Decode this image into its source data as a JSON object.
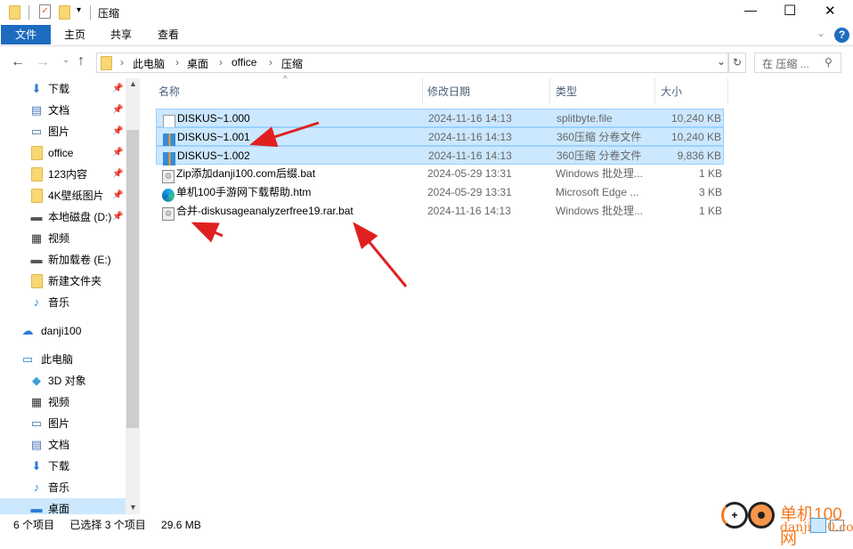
{
  "window": {
    "title": "压缩",
    "minimize": "—",
    "maximize": "☐",
    "close": "✕",
    "help": "?"
  },
  "ribbon": {
    "tabs": [
      "文件",
      "主页",
      "共享",
      "查看"
    ]
  },
  "address": {
    "crumbs": [
      "此电脑",
      "桌面",
      "office",
      "压缩"
    ],
    "search_placeholder": "在 压缩 ..."
  },
  "nav": {
    "items": [
      {
        "label": "下载",
        "icon": "download-icon",
        "pinned": true
      },
      {
        "label": "文档",
        "icon": "document-icon",
        "pinned": true
      },
      {
        "label": "图片",
        "icon": "picture-icon",
        "pinned": true
      },
      {
        "label": "office",
        "icon": "folder-icon",
        "pinned": true
      },
      {
        "label": "123内容",
        "icon": "folder-icon",
        "pinned": true
      },
      {
        "label": "4K壁纸图片",
        "icon": "folder-icon",
        "pinned": true
      },
      {
        "label": "本地磁盘 (D:)",
        "icon": "drive-icon",
        "pinned": true
      },
      {
        "label": "视频",
        "icon": "video-icon",
        "pinned": false
      },
      {
        "label": "新加载卷 (E:)",
        "icon": "drive-icon",
        "pinned": false
      },
      {
        "label": "新建文件夹",
        "icon": "folder-icon",
        "pinned": false
      },
      {
        "label": "音乐",
        "icon": "music-icon",
        "pinned": false
      }
    ],
    "cloud": "danji100",
    "pc": "此电脑",
    "pc_items": [
      {
        "label": "3D 对象",
        "icon": "cube-icon"
      },
      {
        "label": "视频",
        "icon": "video-icon"
      },
      {
        "label": "图片",
        "icon": "picture-icon"
      },
      {
        "label": "文档",
        "icon": "document-icon"
      },
      {
        "label": "下载",
        "icon": "download-icon"
      },
      {
        "label": "音乐",
        "icon": "music-icon"
      },
      {
        "label": "桌面",
        "icon": "desktop-icon",
        "selected": true
      }
    ]
  },
  "columns": [
    "名称",
    "修改日期",
    "类型",
    "大小"
  ],
  "files": [
    {
      "name": "DISKUS~1.000",
      "date": "2024-11-16 14:13",
      "type": "splitbyte.file",
      "size": "10,240 KB",
      "icon": "file-icon",
      "selected": true
    },
    {
      "name": "DISKUS~1.001",
      "date": "2024-11-16 14:13",
      "type": "360压缩 分卷文件",
      "size": "10,240 KB",
      "icon": "archive-icon",
      "selected": true
    },
    {
      "name": "DISKUS~1.002",
      "date": "2024-11-16 14:13",
      "type": "360压缩 分卷文件",
      "size": "9,836 KB",
      "icon": "archive-icon",
      "selected": true
    },
    {
      "name": "Zip添加danji100.com后缀.bat",
      "date": "2024-05-29 13:31",
      "type": "Windows 批处理...",
      "size": "1 KB",
      "icon": "batch-icon",
      "selected": false
    },
    {
      "name": "单机100手游网下载帮助.htm",
      "date": "2024-05-29 13:31",
      "type": "Microsoft Edge ...",
      "size": "3 KB",
      "icon": "edge-icon",
      "selected": false
    },
    {
      "name": "合并-diskusageanalyzerfree19.rar.bat",
      "date": "2024-11-16 14:13",
      "type": "Windows 批处理...",
      "size": "1 KB",
      "icon": "batch-icon",
      "selected": false
    }
  ],
  "status": {
    "count": "6 个项目",
    "selected": "已选择 3 个项目",
    "size": "29.6 MB"
  },
  "watermark": {
    "text1": "单机100网",
    "text2": "danji100.com"
  },
  "colors": {
    "accent": "#1e6cbf",
    "selection": "#cce8ff",
    "arrow": "#e02020",
    "watermark": "#f47a20"
  }
}
